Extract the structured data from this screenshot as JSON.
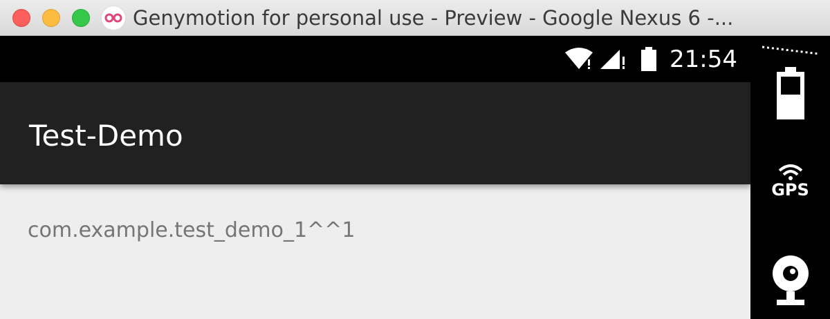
{
  "window": {
    "title": "Genymotion for personal use - Preview - Google Nexus 6 -..."
  },
  "statusbar": {
    "time": "21:54",
    "icons": [
      "wifi-icon",
      "signal-icon",
      "battery-icon"
    ]
  },
  "app": {
    "title": "Test-Demo",
    "content_text": "com.example.test_demo_1^^1"
  },
  "sidebar": {
    "gps_label": "GPS",
    "icons": [
      "battery-widget-icon",
      "gps-icon",
      "webcam-icon"
    ]
  },
  "colors": {
    "appbar": "#212121",
    "background": "#eeeeee",
    "statusbar": "#000000",
    "content_text": "#757575"
  }
}
